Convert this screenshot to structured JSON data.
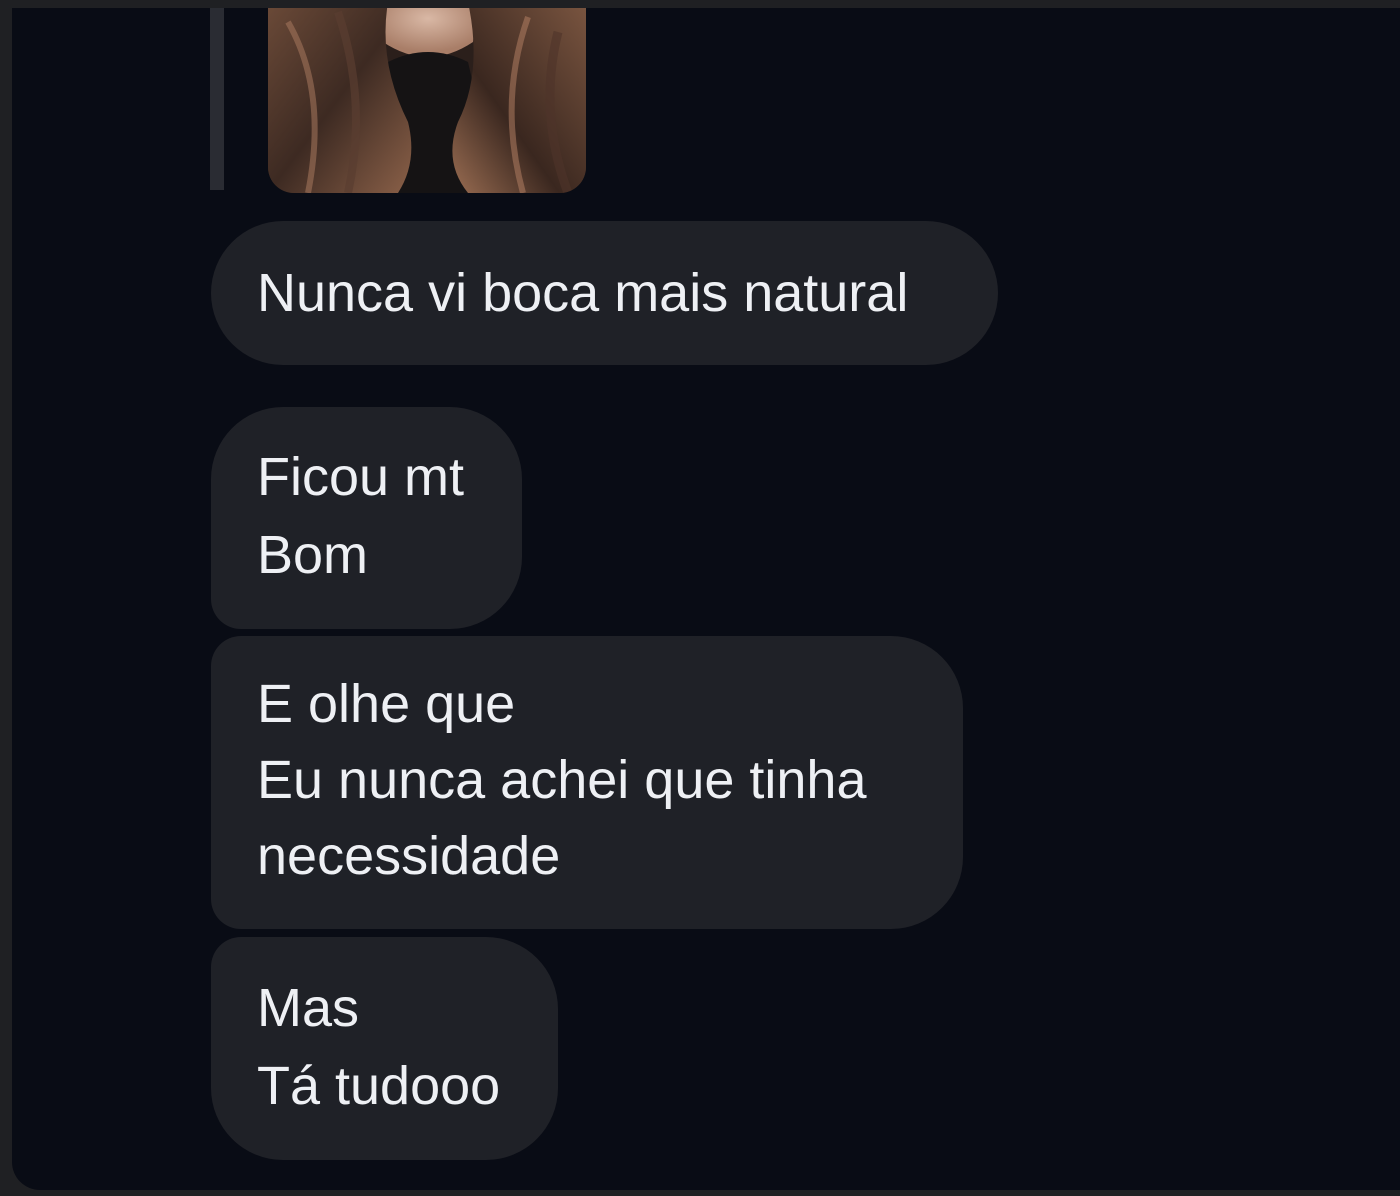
{
  "conversation": {
    "reply_preview": {
      "image_description": ""
    },
    "messages": [
      {
        "lines": [
          "Nunca vi boca mais natural"
        ]
      },
      {
        "lines": [
          "Ficou mt",
          "Bom"
        ]
      },
      {
        "lines": [
          "E olhe que",
          "Eu nunca achei que tinha",
          "necessidade"
        ]
      },
      {
        "lines": [
          "Mas",
          "Tá tudooo"
        ]
      }
    ]
  },
  "colors": {
    "background": "#090c15",
    "bubble": "#1f2127",
    "text": "#eef0f4",
    "frame": "#1f2023"
  }
}
